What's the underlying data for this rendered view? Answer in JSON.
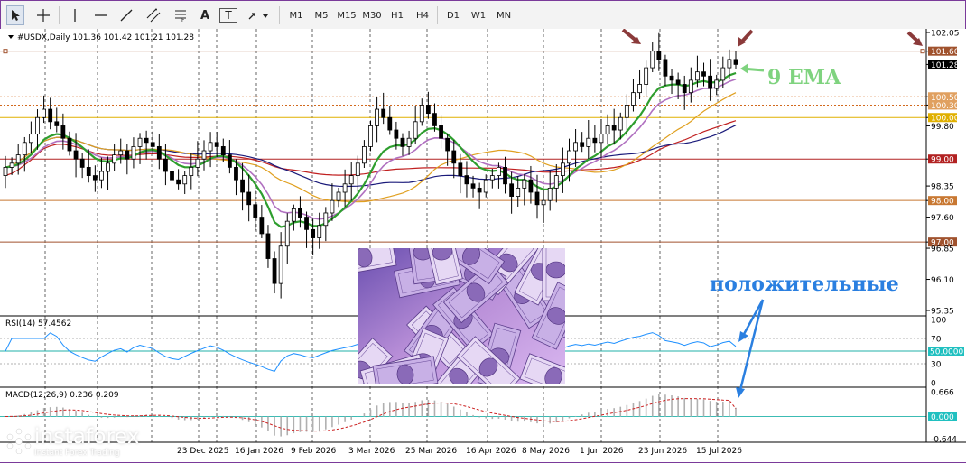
{
  "toolbar": {
    "tools": [
      {
        "name": "cursor-tool-button",
        "icon": "cursor-icon"
      },
      {
        "name": "crosshair-tool-button",
        "icon": "crosshair-icon"
      },
      {
        "name": "vertical-line-tool-button",
        "icon": "vertical-line-icon"
      },
      {
        "name": "horizontal-line-tool-button",
        "icon": "horizontal-line-icon"
      },
      {
        "name": "trendline-tool-button",
        "icon": "trendline-icon"
      },
      {
        "name": "channel-tool-button",
        "icon": "channel-icon"
      },
      {
        "name": "fibonacci-tool-button",
        "icon": "fibonacci-icon"
      },
      {
        "name": "text-tool-button",
        "icon": "text-icon"
      },
      {
        "name": "label-tool-button",
        "icon": "label-icon"
      },
      {
        "name": "arrows-tool-button",
        "icon": "arrows-icon"
      }
    ],
    "timeframes": [
      "M1",
      "M5",
      "M15",
      "M30",
      "H1",
      "H4",
      "D1",
      "W1",
      "MN"
    ],
    "text_tool_label": "A",
    "label_tool_label": "T"
  },
  "main_panel": {
    "header": "#USDX,Daily  101.36 101.42 101.21 101.28",
    "price_axis": [
      "102.05",
      "101.60",
      "101.28",
      "100.50",
      "100.30",
      "100.00",
      "99.80",
      "99.00",
      "98.35",
      "98.00",
      "97.60",
      "97.00",
      "96.85",
      "96.10",
      "95.35"
    ],
    "annotation_ema": "9 EMA",
    "annotation_positive": "положительные"
  },
  "horizontal_levels": [
    {
      "price": "101.60",
      "color": "#a0522d",
      "box": "#a0522d"
    },
    {
      "price": "101.28",
      "color": "#000000",
      "box": "#000000"
    },
    {
      "price": "100.50",
      "color": "#d2691e",
      "box": "#e0a060"
    },
    {
      "price": "100.30",
      "color": "#d2691e",
      "box": "#e0a060"
    },
    {
      "price": "100.00",
      "color": "#e0b000",
      "box": "#e0b000"
    },
    {
      "price": "99.00",
      "color": "#b22222",
      "box": "#b22222"
    },
    {
      "price": "98.00",
      "color": "#c87832",
      "box": "#c87832"
    },
    {
      "price": "97.00",
      "color": "#a0522d",
      "box": "#a0522d"
    }
  ],
  "rsi_panel": {
    "header": "RSI(14) 57.4562",
    "axis": [
      "100",
      "70",
      "50.0000",
      "30",
      "0"
    ],
    "level": "50.0000"
  },
  "macd_panel": {
    "header": "MACD(12,26,9) 0.236 0.209",
    "axis": [
      "0.666",
      "0.000",
      "-0.644"
    ],
    "zero": "0.000"
  },
  "date_axis": [
    "23 Dec 2025",
    "16 Jan 2026",
    "9 Feb 2026",
    "3 Mar 2026",
    "25 Mar 2026",
    "16 Apr 2026",
    "8 May 2026",
    "1 Jun 2026",
    "23 Jun 2026",
    "15 Jul 2026"
  ],
  "branding": {
    "name": "instaforex",
    "tagline": "Instant Forex Trading"
  },
  "colors": {
    "candle": "#000000",
    "ema9": "#2e9e2e",
    "ma_fast": "#b070c0",
    "ma_mid": "#e0a020",
    "ma_slow": "#1a1a7a",
    "ma_slowest": "#c02020",
    "rsi": "#1e90ff",
    "macd_signal": "#cc2222",
    "annotation_text": "#2a7fe0",
    "ema_text": "#7fd37f",
    "arrow": "#8b3a3a"
  },
  "chart_data": {
    "type": "candlestick",
    "symbol": "#USDX",
    "timeframe": "Daily",
    "ohlc_last": {
      "open": 101.36,
      "high": 101.42,
      "low": 101.21,
      "close": 101.28
    },
    "ylim": [
      95.35,
      102.05
    ],
    "x_labels": [
      "23 Dec 2025",
      "16 Jan 2026",
      "9 Feb 2026",
      "3 Mar 2026",
      "25 Mar 2026",
      "16 Apr 2026",
      "8 May 2026",
      "1 Jun 2026",
      "23 Jun 2026",
      "15 Jul 2026"
    ],
    "closes": [
      98.8,
      98.9,
      99.1,
      99.4,
      99.6,
      100.0,
      100.2,
      99.9,
      99.8,
      99.5,
      99.2,
      99.0,
      98.8,
      98.6,
      98.5,
      98.7,
      98.9,
      99.1,
      99.2,
      99.0,
      99.3,
      99.5,
      99.4,
      99.3,
      99.0,
      98.7,
      98.5,
      98.4,
      98.6,
      98.8,
      99.0,
      99.2,
      99.4,
      99.3,
      99.1,
      98.8,
      98.5,
      98.2,
      97.9,
      97.6,
      97.2,
      96.6,
      96.0,
      96.9,
      97.5,
      97.8,
      97.6,
      97.3,
      97.1,
      97.4,
      97.7,
      98.0,
      98.2,
      98.4,
      98.6,
      98.9,
      99.3,
      99.8,
      100.2,
      100.0,
      99.7,
      99.5,
      99.3,
      99.5,
      99.9,
      100.3,
      100.1,
      99.8,
      99.5,
      99.2,
      98.9,
      98.6,
      98.4,
      98.3,
      98.2,
      98.5,
      98.6,
      98.8,
      98.4,
      98.1,
      98.3,
      98.5,
      98.2,
      97.9,
      98.0,
      98.3,
      98.6,
      98.9,
      99.2,
      99.4,
      99.3,
      99.5,
      99.4,
      99.6,
      99.8,
      99.7,
      100.0,
      100.3,
      100.6,
      100.8,
      101.2,
      101.6,
      101.4,
      101.0,
      100.9,
      100.8,
      100.6,
      100.9,
      101.1,
      101.0,
      100.7,
      100.9,
      101.2,
      101.4,
      101.28
    ],
    "rsi": {
      "value": 57.4562,
      "levels": [
        70,
        50,
        30
      ],
      "range": [
        0,
        100
      ]
    },
    "macd": {
      "fast": 12,
      "slow": 26,
      "signal": 9,
      "main": 0.236,
      "signal_value": 0.209,
      "range": [
        -0.644,
        0.666
      ]
    }
  }
}
